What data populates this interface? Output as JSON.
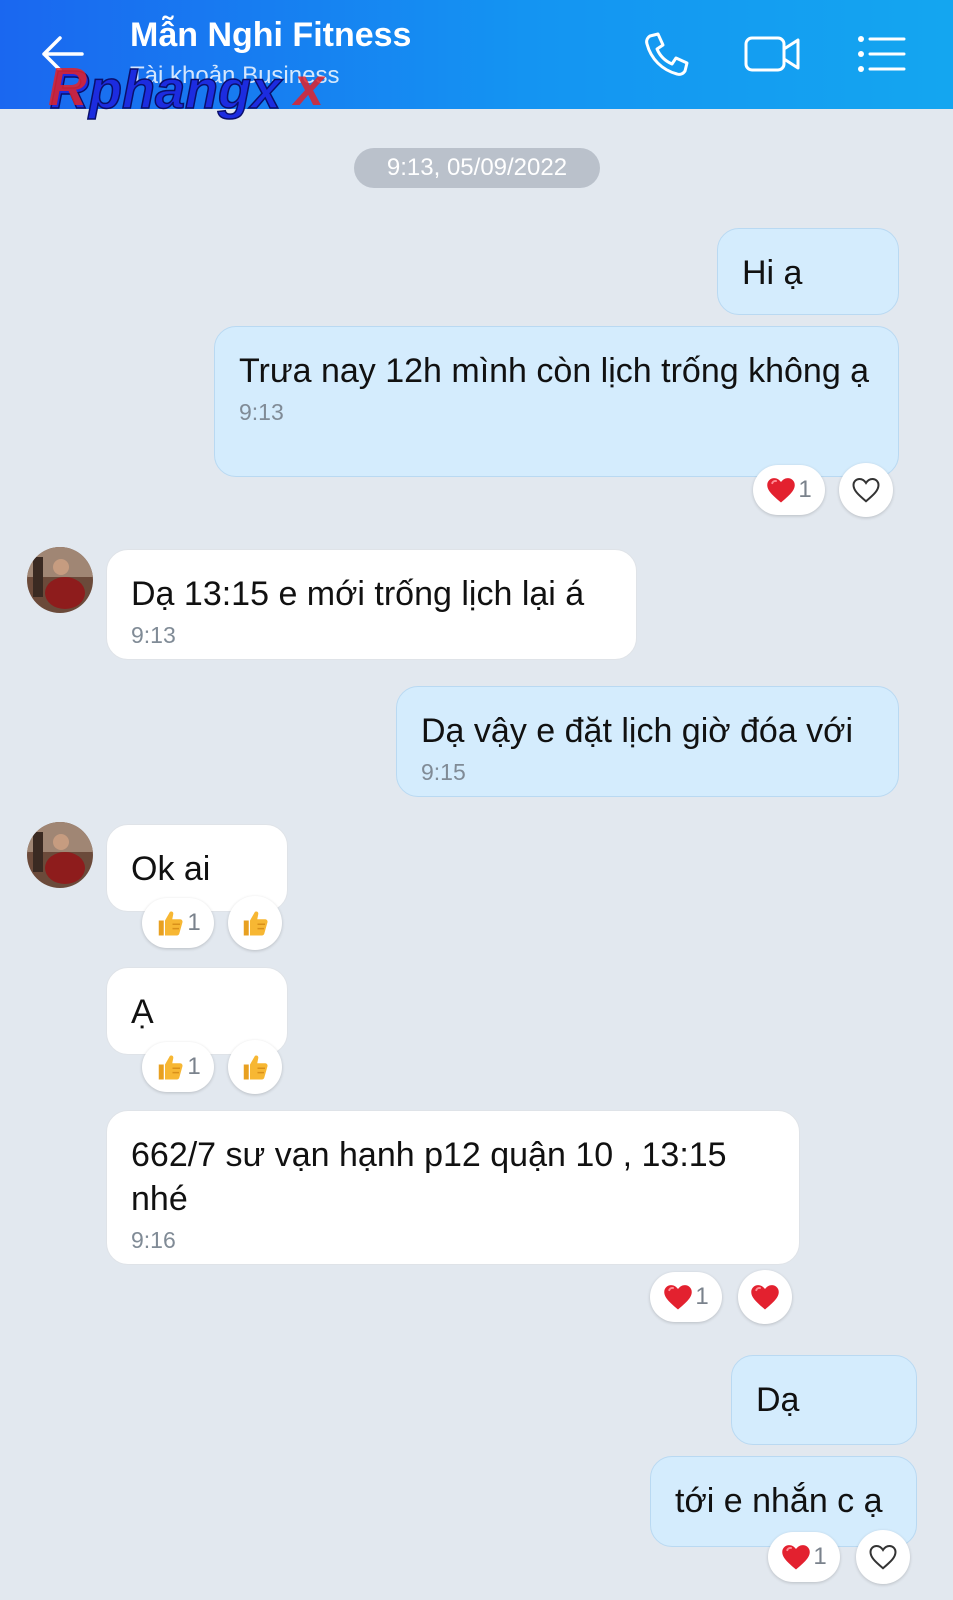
{
  "header": {
    "title": "Mẫn Nghi Fitness",
    "subtitle": "Tài khoản Business",
    "watermark": "Rphangx"
  },
  "colors": {
    "header_start": "#1a67f0",
    "header_end": "#14a6f0",
    "outgoing_bubble": "#d4ecfd",
    "incoming_bubble": "#ffffff",
    "background": "#e2e8ef"
  },
  "date_separator": "9:13, 05/09/2022",
  "messages": [
    {
      "dir": "out",
      "text": "Hi ạ",
      "time": ""
    },
    {
      "dir": "out",
      "text": "Trưa nay 12h mình còn lịch trống không ạ",
      "time": "9:13",
      "reaction": {
        "emoji": "heart",
        "count": "1",
        "button": "heart-outline"
      }
    },
    {
      "dir": "in",
      "text": "Dạ 13:15 e mới trống lịch lại á",
      "time": "9:13"
    },
    {
      "dir": "out",
      "text": "Dạ vậy e đặt lịch giờ đóa với",
      "time": "9:15"
    },
    {
      "dir": "in",
      "text": "Ok ai",
      "time": "",
      "reaction": {
        "emoji": "thumbs-up",
        "count": "1",
        "button": "thumbs-up"
      }
    },
    {
      "dir": "in",
      "text": "Ạ",
      "time": "",
      "reaction": {
        "emoji": "thumbs-up",
        "count": "1",
        "button": "thumbs-up"
      }
    },
    {
      "dir": "in",
      "text": "662/7 sư vạn hạnh p12 quận 10 , 13:15 nhé",
      "time": "9:16",
      "reaction": {
        "emoji": "heart",
        "count": "1",
        "button": "heart"
      }
    },
    {
      "dir": "out",
      "text": "Dạ",
      "time": ""
    },
    {
      "dir": "out",
      "text": "tới e nhắn c ạ",
      "time": "",
      "reaction": {
        "emoji": "heart",
        "count": "1",
        "button": "heart-outline"
      }
    }
  ]
}
